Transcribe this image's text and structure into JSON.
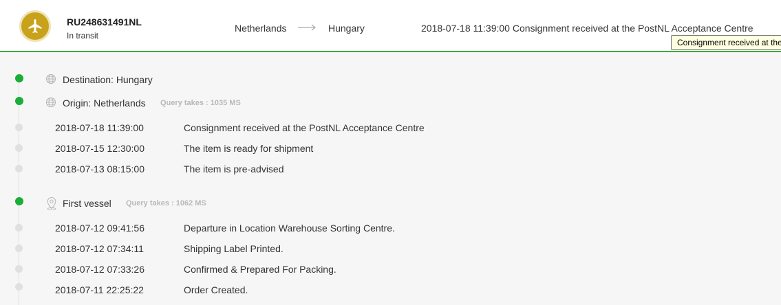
{
  "header": {
    "tracking_number": "RU248631491NL",
    "status": "In transit",
    "status_icon": "airplane-icon",
    "origin_country": "Netherlands",
    "destination_country": "Hungary",
    "latest_event": "2018-07-18 11:39:00 Consignment received at the PostNL Acceptance Centre",
    "tooltip": "Consignment received at the PostNL Acceptance Centre"
  },
  "colors": {
    "accent_green": "#1aad38",
    "status_gold": "#c9a21b"
  },
  "destination": {
    "label": "Destination: Hungary",
    "icon": "globe-icon"
  },
  "origin": {
    "label": "Origin: Netherlands",
    "icon": "globe-icon",
    "query_time": "Query takes : 1035 MS",
    "events": [
      {
        "date": "2018-07-18 11:39:00",
        "desc": "Consignment received at the PostNL Acceptance Centre"
      },
      {
        "date": "2018-07-15 12:30:00",
        "desc": "The item is ready for shipment"
      },
      {
        "date": "2018-07-13 08:15:00",
        "desc": "The item is pre-advised"
      }
    ]
  },
  "first_vessel": {
    "label": "First vessel",
    "icon": "location-pin-icon",
    "query_time": "Query takes : 1062 MS",
    "events": [
      {
        "date": "2018-07-12 09:41:56",
        "desc": "Departure in Location Warehouse Sorting Centre."
      },
      {
        "date": "2018-07-12 07:34:11",
        "desc": "Shipping Label Printed."
      },
      {
        "date": "2018-07-12 07:33:26",
        "desc": "Confirmed & Prepared For Packing."
      },
      {
        "date": "2018-07-11 22:25:22",
        "desc": "Order Created."
      }
    ]
  }
}
